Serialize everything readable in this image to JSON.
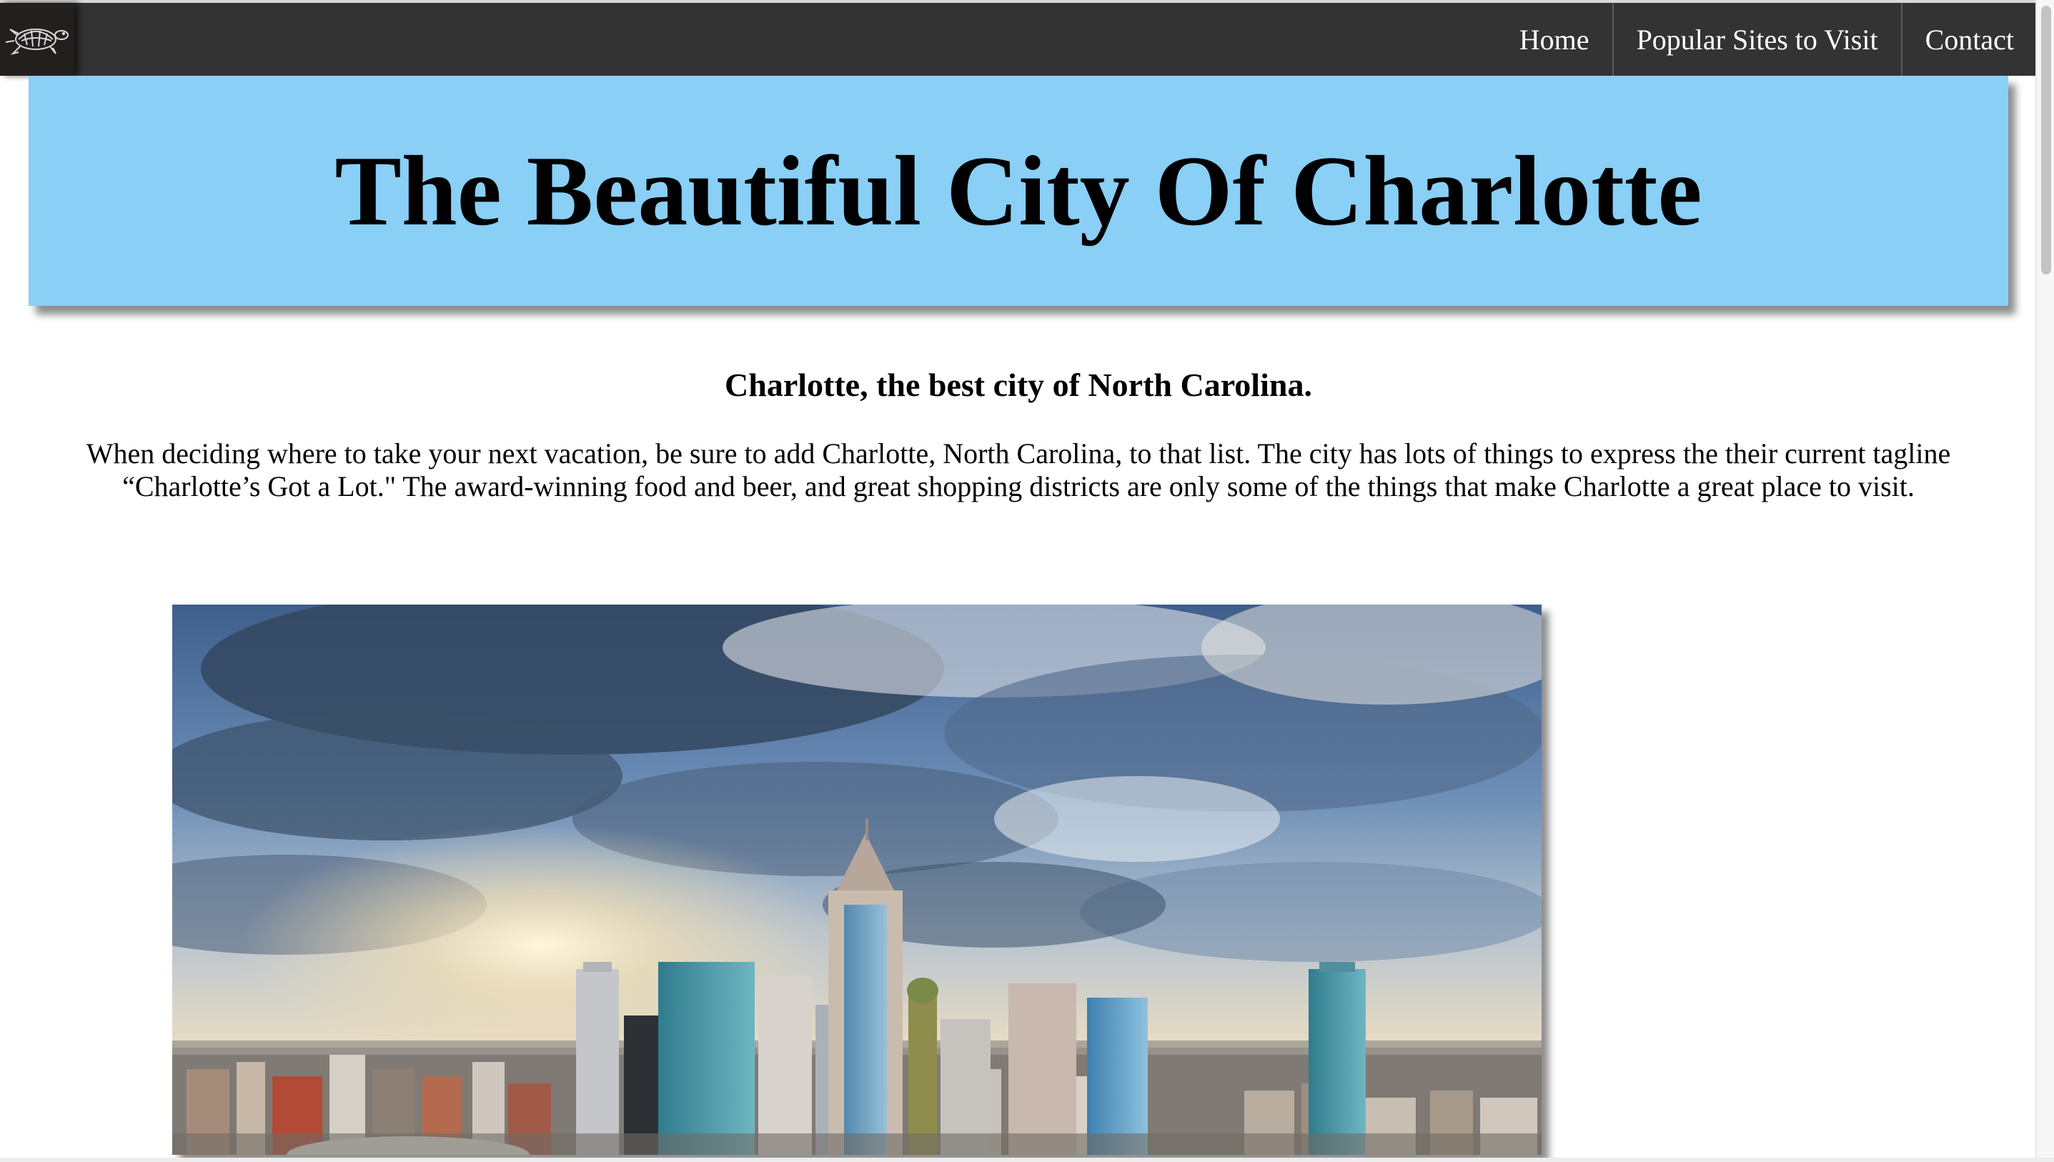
{
  "navbar": {
    "logo_icon": "turtle-icon",
    "links": [
      {
        "label": "Home"
      },
      {
        "label": "Popular Sites to Visit"
      },
      {
        "label": "Contact"
      }
    ]
  },
  "hero": {
    "title": "The Beautiful City Of Charlotte",
    "background_color": "#89cff6"
  },
  "intro": {
    "subtitle": "Charlotte, the best city of North Carolina.",
    "body": "When deciding where to take your next vacation, be sure to add Charlotte, North Carolina, to that list. The city has lots of things to express the their current tagline “Charlotte’s Got a Lot.\" The award-winning food and beer, and great shopping districts are only some of the things that make Charlotte a great place to visit."
  },
  "photo": {
    "subject": "charlotte-skyline-photo"
  },
  "colors": {
    "navbar_bg": "#333333",
    "logo_bg": "#231f1f",
    "nav_text": "#ffffff"
  }
}
